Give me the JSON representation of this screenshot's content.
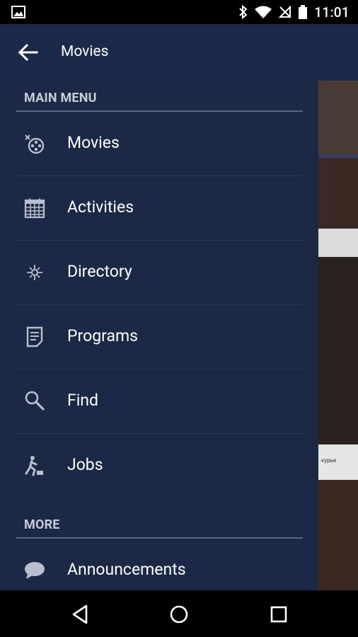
{
  "status_bar": {
    "time": "11:01"
  },
  "app_bar": {
    "title": "Movies"
  },
  "drawer": {
    "main_menu_header": "MAIN MENU",
    "main_items": [
      {
        "label": "Movies",
        "icon": "film-reel-icon"
      },
      {
        "label": "Activities",
        "icon": "calendar-icon"
      },
      {
        "label": "Directory",
        "icon": "sparkle-icon"
      },
      {
        "label": "Programs",
        "icon": "document-icon"
      },
      {
        "label": "Find",
        "icon": "search-icon"
      },
      {
        "label": "Jobs",
        "icon": "worker-icon"
      }
    ],
    "more_header": "MORE",
    "more_items": [
      {
        "label": "Announcements",
        "icon": "chat-bubble-icon"
      }
    ]
  },
  "content_strip": {
    "caption": "курье"
  },
  "colors": {
    "drawer_bg": "#1b2846",
    "appbar_bg": "#1b2a48",
    "divider": "#56698a"
  }
}
